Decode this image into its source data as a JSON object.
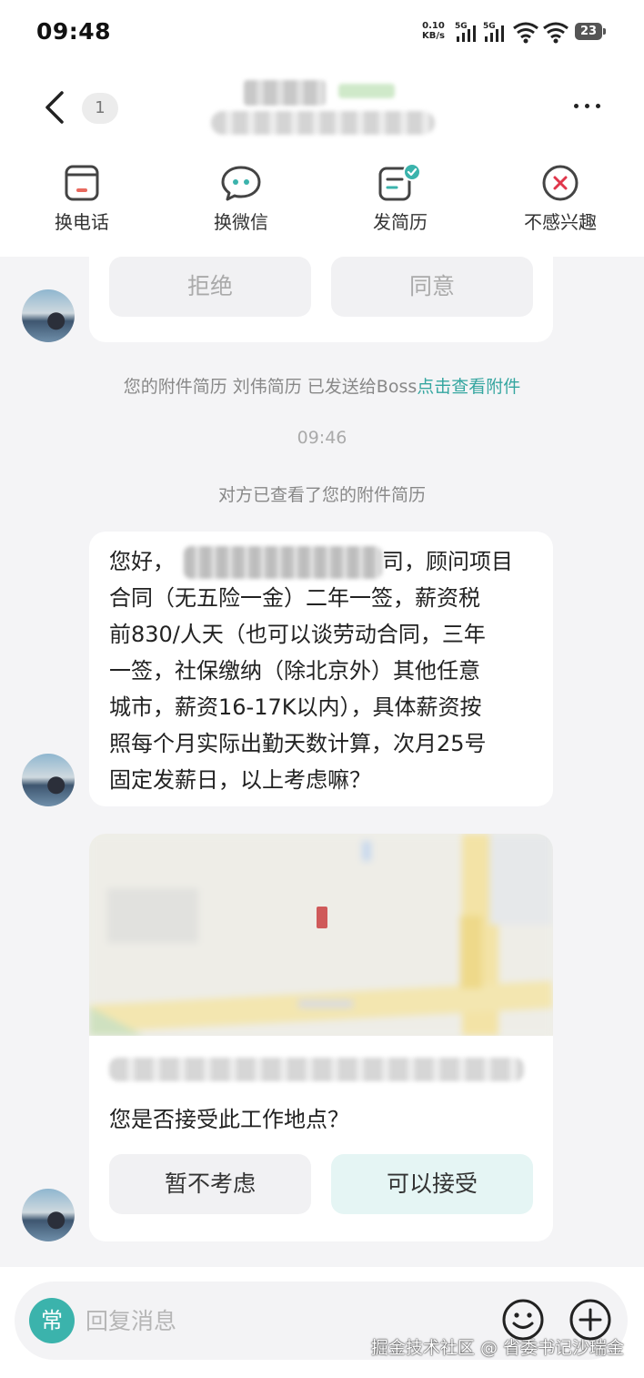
{
  "status_bar": {
    "time": "09:48",
    "net_speed_value": "0.10",
    "net_speed_unit": "KB/s",
    "signal_1": "5G",
    "signal_2": "5G",
    "battery": "23"
  },
  "header": {
    "unread_count": "1",
    "actions": [
      {
        "label": "换电话",
        "icon": "phone-card-icon"
      },
      {
        "label": "换微信",
        "icon": "wechat-bubble-icon"
      },
      {
        "label": "发简历",
        "icon": "resume-sent-icon"
      },
      {
        "label": "不感兴趣",
        "icon": "not-interested-icon"
      }
    ]
  },
  "chat": {
    "exchange_card": {
      "reject_label": "拒绝",
      "agree_label": "同意"
    },
    "resume_notice": {
      "text": "您的附件简历 刘伟简历 已发送给Boss",
      "link": "点击查看附件"
    },
    "timestamp": "09:46",
    "viewed_notice": "对方已查看了您的附件简历",
    "message": {
      "line1_start": "您好，",
      "line1_end": "司，顾问项目",
      "line2": "合同（无五险一金）二年一签，薪资税",
      "line3": "前830/人天（也可以谈劳动合同，三年",
      "line4": "一签，社保缴纳（除北京外）其他任意",
      "line5": "城市，薪资16-17K以内），具体薪资按",
      "line6": "照每个月实际出勤天数计算，次月25号",
      "line7": "固定发薪日，以上考虑嘛？"
    },
    "location_card": {
      "question": "您是否接受此工作地点？",
      "decline_label": "暂不考虑",
      "accept_label": "可以接受"
    }
  },
  "input": {
    "common_phrases_label": "常",
    "placeholder": "回复消息"
  },
  "watermark": "掘金技术社区 @ 省委书记沙瑞金",
  "colors": {
    "accent": "#3bb3ac",
    "link": "#35a6a0",
    "danger": "#e0364b"
  }
}
